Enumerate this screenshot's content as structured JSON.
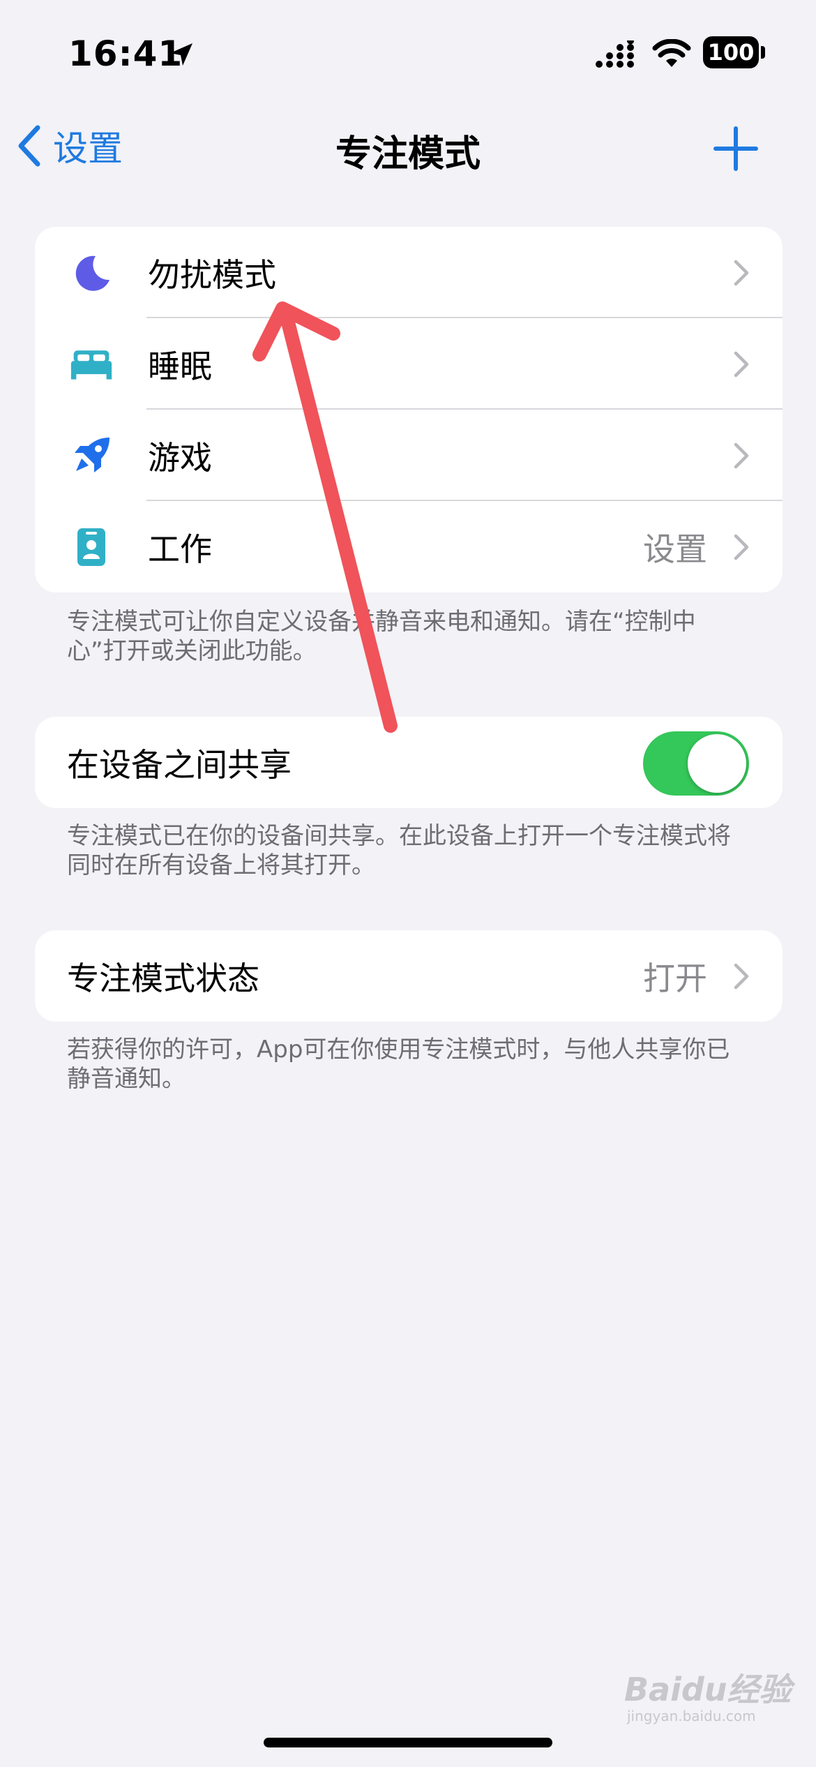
{
  "status_bar": {
    "time": "16:41",
    "battery": "100"
  },
  "nav": {
    "back_label": "设置",
    "title": "专注模式"
  },
  "focus_modes": [
    {
      "label": "勿扰模式",
      "value": "",
      "icon": "moon-icon"
    },
    {
      "label": "睡眠",
      "value": "",
      "icon": "bed-icon"
    },
    {
      "label": "游戏",
      "value": "",
      "icon": "rocket-icon"
    },
    {
      "label": "工作",
      "value": "设置",
      "icon": "id-badge-icon"
    }
  ],
  "focus_modes_footer": "专注模式可让你自定义设备并静音来电和通知。请在“控制中心”打开或关闭此功能。",
  "share": {
    "label": "在设备之间共享",
    "enabled": true,
    "footer": "专注模式已在你的设备间共享。在此设备上打开一个专注模式将同时在所有设备上将其打开。"
  },
  "focus_status": {
    "label": "专注模式状态",
    "value": "打开",
    "footer": "若获得你的许可，App可在你使用专注模式时，与他人共享你已静音通知。"
  },
  "watermark": {
    "brand": "Baidu经验",
    "url": "jingyan.baidu.com"
  },
  "colors": {
    "accent": "#1f7ae0",
    "toggle_on": "#34c759",
    "moon": "#5e5ce6",
    "teal": "#30b0c7",
    "rocket": "#1f6feb",
    "arrow": "#f0535a"
  }
}
